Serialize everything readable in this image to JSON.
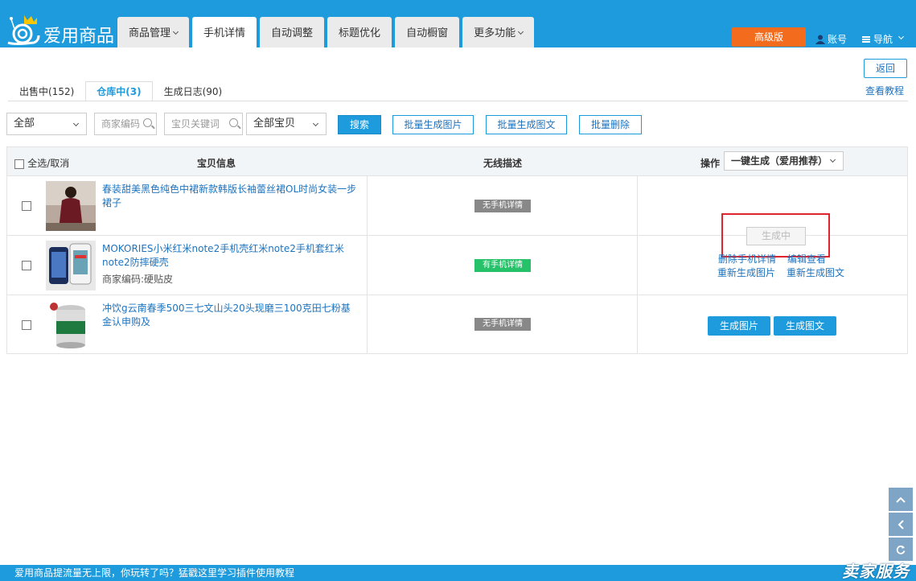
{
  "app": {
    "logo_text": "爱用商品"
  },
  "nav": {
    "tabs": [
      {
        "label": "商品管理",
        "has_dropdown": true
      },
      {
        "label": "手机详情",
        "active": true
      },
      {
        "label": "自动调整"
      },
      {
        "label": "标题优化"
      },
      {
        "label": "自动橱窗"
      },
      {
        "label": "更多功能",
        "has_dropdown": true
      }
    ],
    "premium": "高级版",
    "account": "账号",
    "menu": "导航"
  },
  "actions": {
    "back": "返回",
    "tutorial": "查看教程"
  },
  "subtabs": [
    {
      "label": "出售中(152)"
    },
    {
      "label": "仓库中(3)",
      "active": true
    },
    {
      "label": "生成日志(90)"
    }
  ],
  "filters": {
    "category": "全部",
    "code_placeholder": "商家编码",
    "keyword_placeholder": "宝贝关键词",
    "items_scope": "全部宝贝",
    "search": "搜索",
    "batch_images": "批量生成图片",
    "batch_text": "批量生成图文",
    "batch_delete": "批量删除"
  },
  "table": {
    "headers": {
      "select_all": "全选/取消",
      "item_info": "宝贝信息",
      "mobile_desc": "无线描述",
      "ops": "操作"
    },
    "one_click": "一键生成（爱用推荐）",
    "rows": [
      {
        "title": "春装甜美黑色纯色中裙新款韩版长袖蕾丝裙OL时尚女装一步裙子",
        "code": "",
        "badge": "无手机详情",
        "badge_status": "none",
        "generating": "生成中"
      },
      {
        "title": "MOKORIES小米红米note2手机壳红米note2手机套红米note2防摔硬壳",
        "code": "商家编码:硬贴皮",
        "badge": "有手机详情",
        "badge_status": "has",
        "links": [
          "删除手机详情",
          "编辑查看",
          "重新生成图片",
          "重新生成图文"
        ]
      },
      {
        "title": "冲饮g云南春季500三七文山头20头现磨三100克田七粉基金认申购及",
        "code": "",
        "badge": "无手机详情",
        "badge_status": "none",
        "buttons": [
          "生成图片",
          "生成图文"
        ]
      }
    ]
  },
  "footer": {
    "text": "爱用商品提流量无上限，你玩转了吗？猛戳这里学习插件使用教程",
    "brand": "卖家服务"
  },
  "colors": {
    "primary": "#1e9bdc",
    "premium": "#f36c1d",
    "highlight": "#e0242e",
    "success": "#26c26a"
  }
}
